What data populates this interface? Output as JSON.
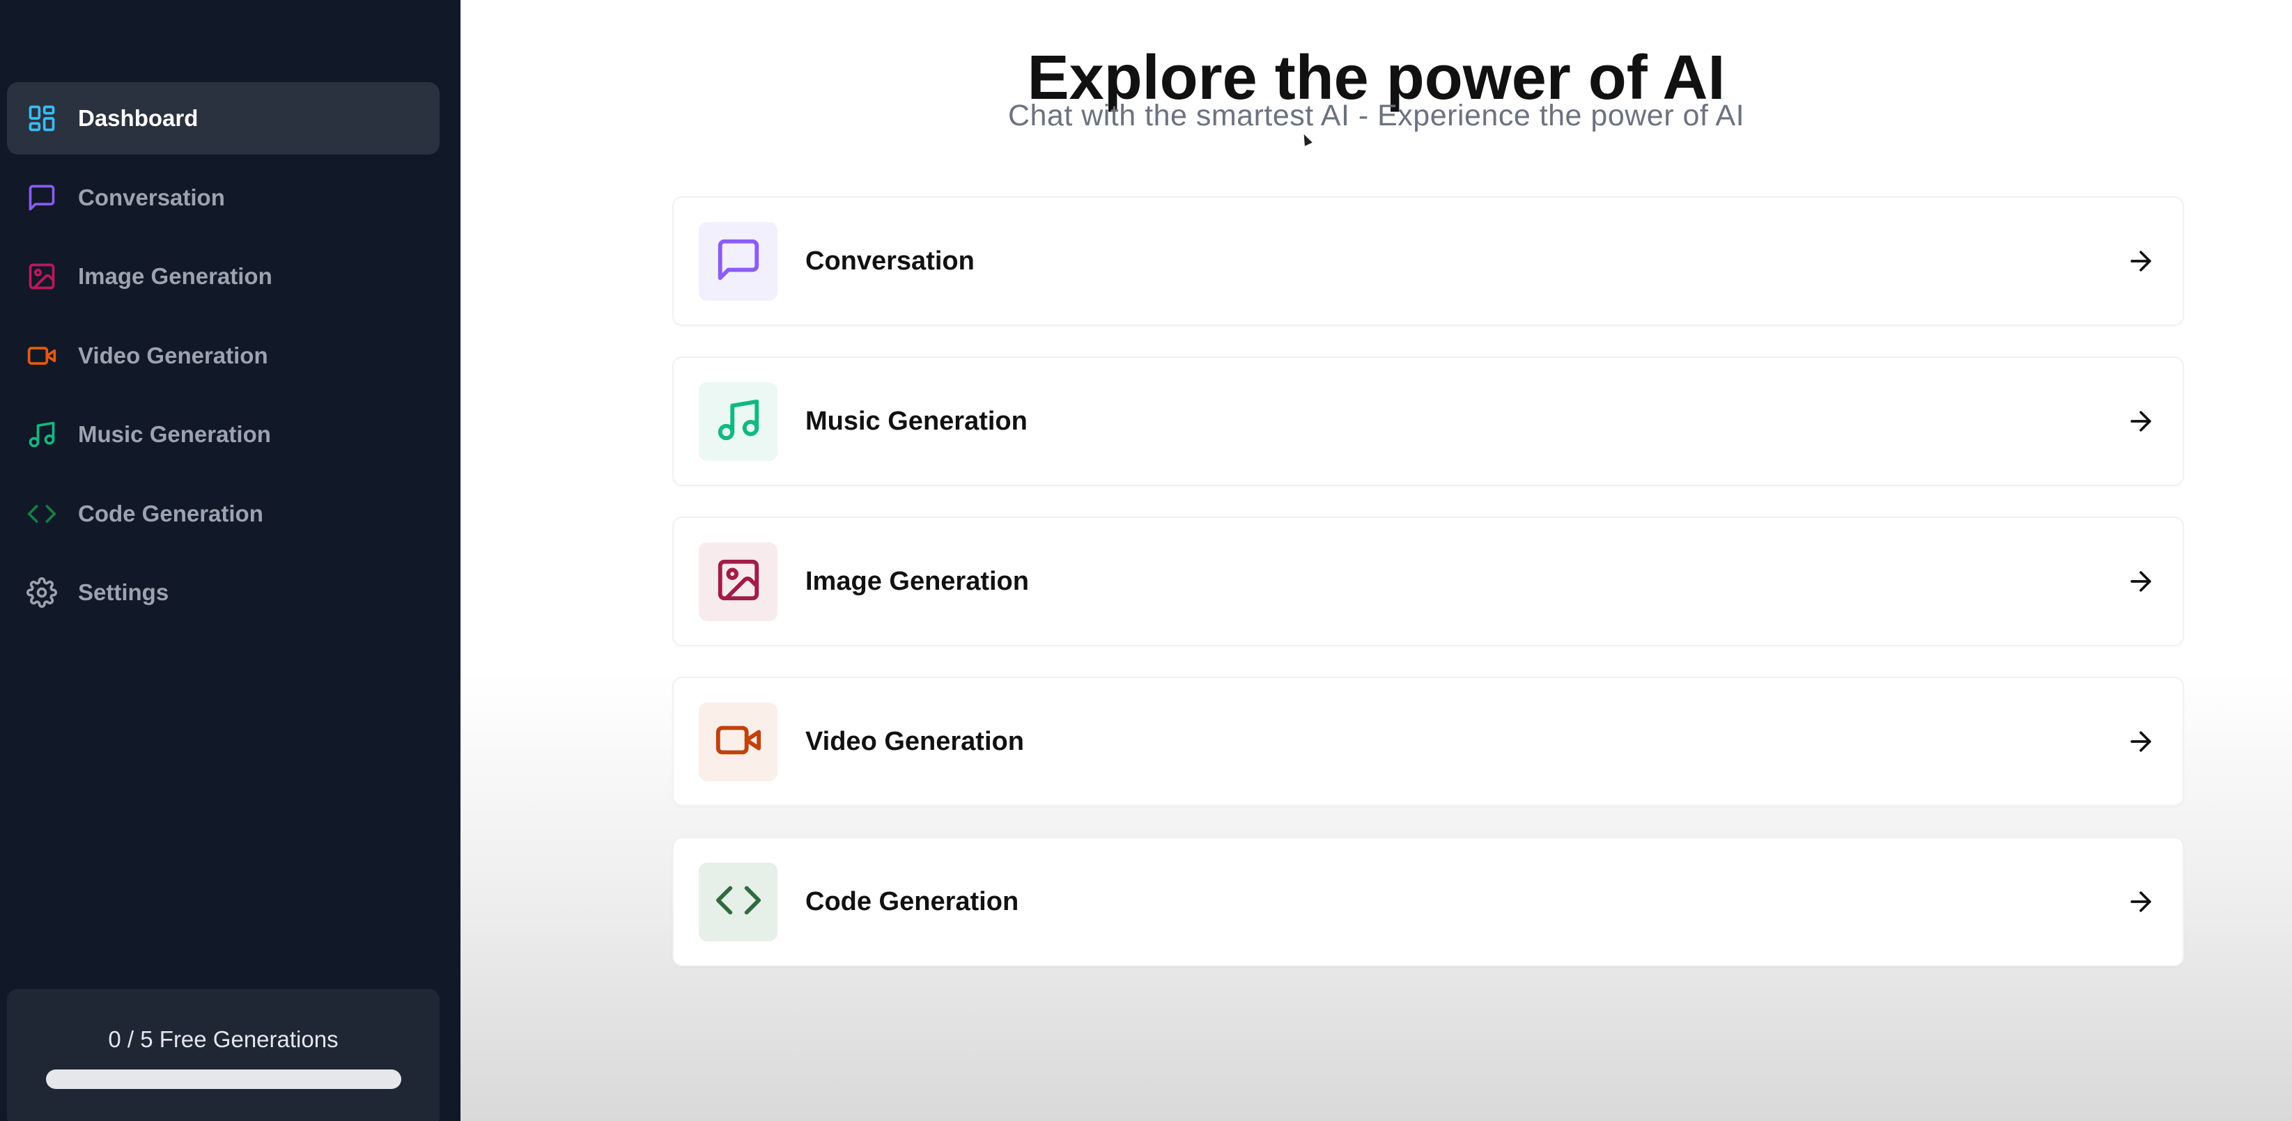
{
  "sidebar": {
    "items": [
      {
        "label": "Dashboard",
        "icon": "dashboard-icon",
        "color": "#38bdf8",
        "active": true
      },
      {
        "label": "Conversation",
        "icon": "message-square-icon",
        "color": "#8b5cf6"
      },
      {
        "label": "Image Generation",
        "icon": "image-icon",
        "color": "#be185d"
      },
      {
        "label": "Video Generation",
        "icon": "video-icon",
        "color": "#ea580c"
      },
      {
        "label": "Music Generation",
        "icon": "music-icon",
        "color": "#10b981"
      },
      {
        "label": "Code Generation",
        "icon": "code-icon",
        "color": "#15803d"
      },
      {
        "label": "Settings",
        "icon": "settings-icon",
        "color": "#9ca3af"
      }
    ],
    "credits": {
      "text": "0 / 5 Free Generations",
      "used": 0,
      "total": 5,
      "progress": 0
    }
  },
  "main": {
    "title": "Explore the power of AI",
    "subtitle": "Chat with the smartest AI - Experience the power of AI",
    "tools": [
      {
        "label": "Conversation",
        "icon": "message-square-icon",
        "color": "#8b5cf6",
        "bg": "#f3f0fd"
      },
      {
        "label": "Music Generation",
        "icon": "music-icon",
        "color": "#10b981",
        "bg": "#ecf8f3"
      },
      {
        "label": "Image Generation",
        "icon": "image-icon",
        "color": "#a21c48",
        "bg": "#f8ebee"
      },
      {
        "label": "Video Generation",
        "icon": "video-icon",
        "color": "#c2410c",
        "bg": "#fbefe9"
      },
      {
        "label": "Code Generation",
        "icon": "code-icon",
        "color": "#2f6b3f",
        "bg": "#e6efe8"
      }
    ]
  }
}
